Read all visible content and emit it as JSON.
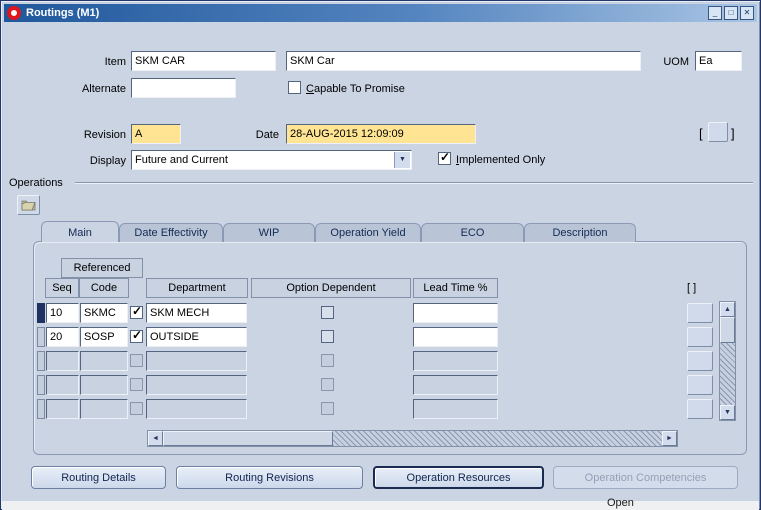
{
  "colors": {
    "titlebar_left": "#20589c",
    "titlebar_right": "#a9c5e4",
    "canvas": "#cbd4e3",
    "required_field_yellow": "#ffe593",
    "oracle_logo_red": "#e0161d"
  },
  "window": {
    "title": "Routings (M1)",
    "minimize_icon": "_",
    "maximize_icon": "□",
    "close_icon": "✕"
  },
  "header": {
    "item": {
      "label": "Item",
      "value": "SKM CAR",
      "description": "SKM Car"
    },
    "uom": {
      "label": "UOM",
      "value": "Ea"
    },
    "alternate": {
      "label": "Alternate",
      "value": ""
    },
    "capable_to_promise": {
      "label": "Capable To Promise",
      "checked": false,
      "mark": ""
    },
    "revision": {
      "label": "Revision",
      "value": "A"
    },
    "date": {
      "label": "Date",
      "value": "28-AUG-2015 12:09:09"
    },
    "flexfield": {
      "open": "[",
      "close": "]"
    },
    "display": {
      "label": "Display",
      "value": "Future and Current"
    },
    "implemented_only": {
      "label": "Implemented Only",
      "checked": true,
      "mark": "✓"
    }
  },
  "operations": {
    "section_label": "Operations",
    "tabs": [
      {
        "label": "Main",
        "active": true
      },
      {
        "label": "Date Effectivity",
        "active": false
      },
      {
        "label": "WIP",
        "active": false
      },
      {
        "label": "Operation Yield",
        "active": false
      },
      {
        "label": "ECO",
        "active": false
      },
      {
        "label": "Description",
        "active": false
      }
    ],
    "grid": {
      "referenced_header": "Referenced",
      "headers": {
        "seq": "Seq",
        "code": "Code",
        "department": "Department",
        "option_dependent": "Option Dependent",
        "lead_time": "Lead Time %",
        "flex": "[ ]"
      },
      "rows": [
        {
          "seq": "10",
          "code": "SKMC",
          "referenced_mark": "✓",
          "department": "SKM MECH",
          "option_dependent_mark": "",
          "lead_time": ""
        },
        {
          "seq": "20",
          "code": "SOSP",
          "referenced_mark": "✓",
          "department": "OUTSIDE",
          "option_dependent_mark": "",
          "lead_time": ""
        },
        {
          "seq": "",
          "code": "",
          "referenced_mark": "",
          "department": "",
          "option_dependent_mark": "",
          "lead_time": ""
        },
        {
          "seq": "",
          "code": "",
          "referenced_mark": "",
          "department": "",
          "option_dependent_mark": "",
          "lead_time": ""
        },
        {
          "seq": "",
          "code": "",
          "referenced_mark": "",
          "department": "",
          "option_dependent_mark": "",
          "lead_time": ""
        }
      ]
    }
  },
  "buttons": {
    "routing_details": "Routing Details",
    "routing_revisions": "Routing Revisions",
    "operation_resources": "Operation Resources",
    "operation_competencies": "Operation Competencies"
  },
  "icons": {
    "combo_arrow": "▼",
    "scroll_up": "▲",
    "scroll_down": "▼",
    "scroll_left": "◄",
    "scroll_right": "►"
  },
  "background": {
    "partial_text": "Open"
  }
}
